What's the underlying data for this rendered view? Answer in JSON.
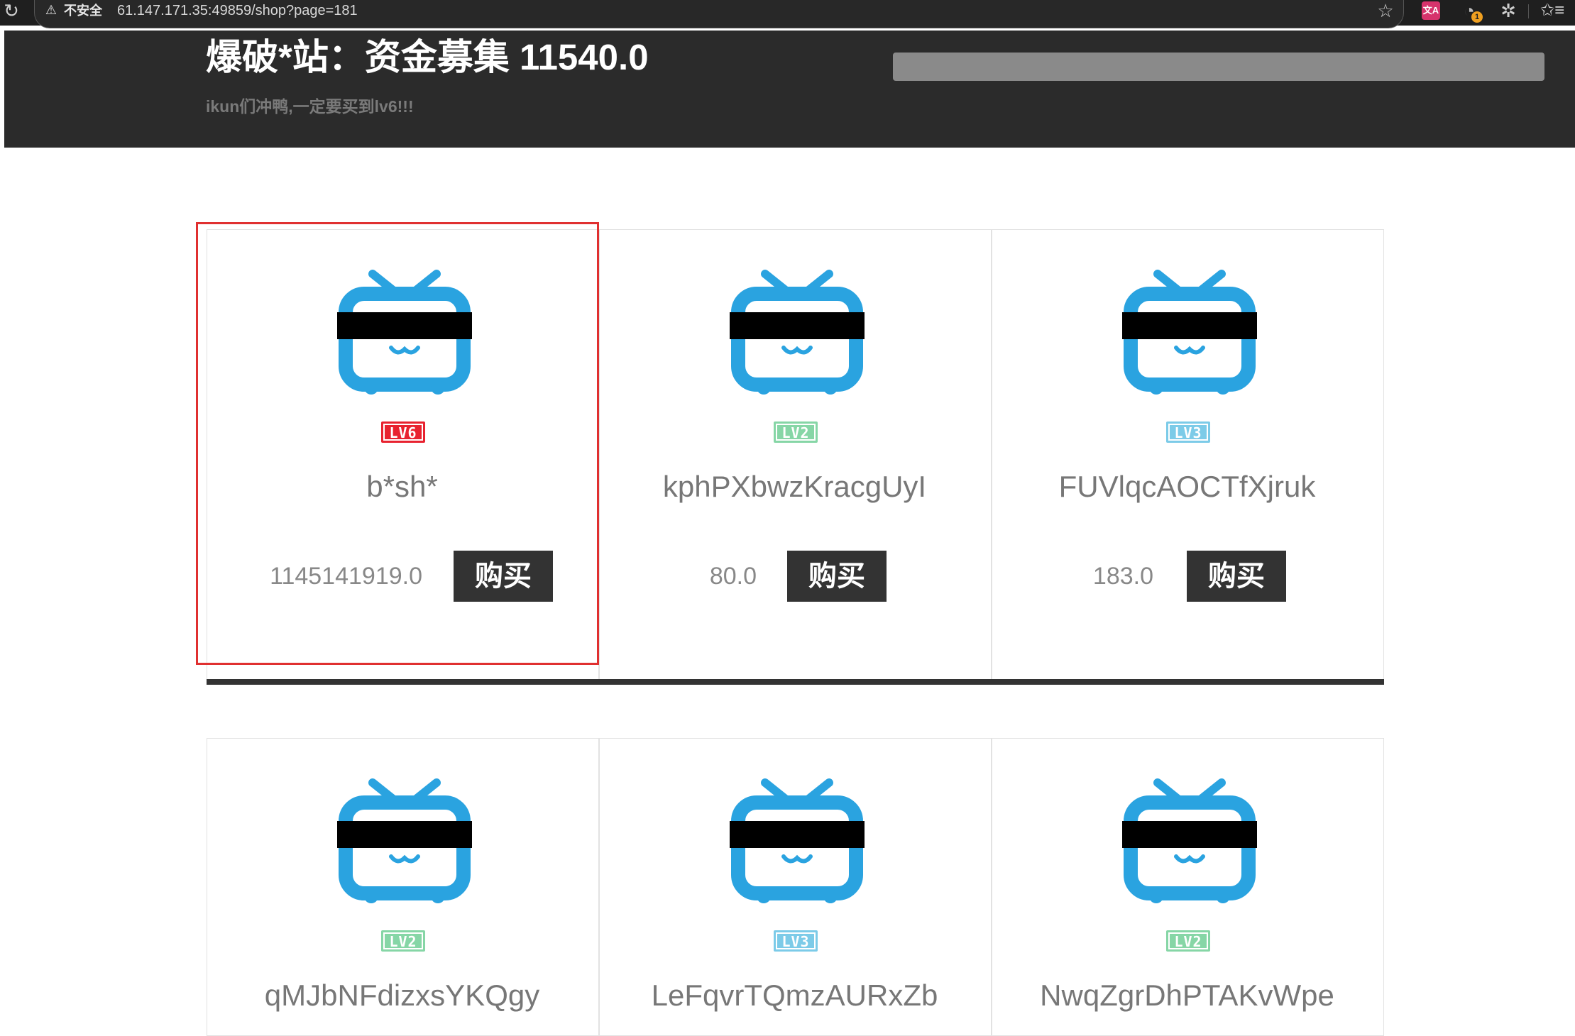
{
  "browser": {
    "security_label": "不安全",
    "url": "61.147.171.35:49859/shop?page=181",
    "ext_badge": "1",
    "translate_icon": "translate-icon"
  },
  "header": {
    "title": "爆破*站：资金募集 11540.0",
    "subtitle": "ikun们冲鸭,一定要买到lv6!!!"
  },
  "colors": {
    "header_bg": "#2b2b2b",
    "tv_blue": "#2aa3e0",
    "lv6_red": "#e8222f",
    "lv2_green": "#86d6a6",
    "lv3_blue": "#7ccbe8",
    "button_bg": "#333333",
    "highlight_red": "#e03030"
  },
  "products": [
    {
      "name": "b*sh*",
      "level": "LV6",
      "price": "1145141919.0",
      "buy_label": "购买"
    },
    {
      "name": "kphPXbwzKracgUyI",
      "level": "LV2",
      "price": "80.0",
      "buy_label": "购买"
    },
    {
      "name": "FUVlqcAOCTfXjruk",
      "level": "LV3",
      "price": "183.0",
      "buy_label": "购买"
    },
    {
      "name": "qMJbNFdizxsYKQgy",
      "level": "LV2"
    },
    {
      "name": "LeFqvrTQmzAURxZb",
      "level": "LV3"
    },
    {
      "name": "NwqZgrDhPTAKvWpe",
      "level": "LV2"
    }
  ]
}
